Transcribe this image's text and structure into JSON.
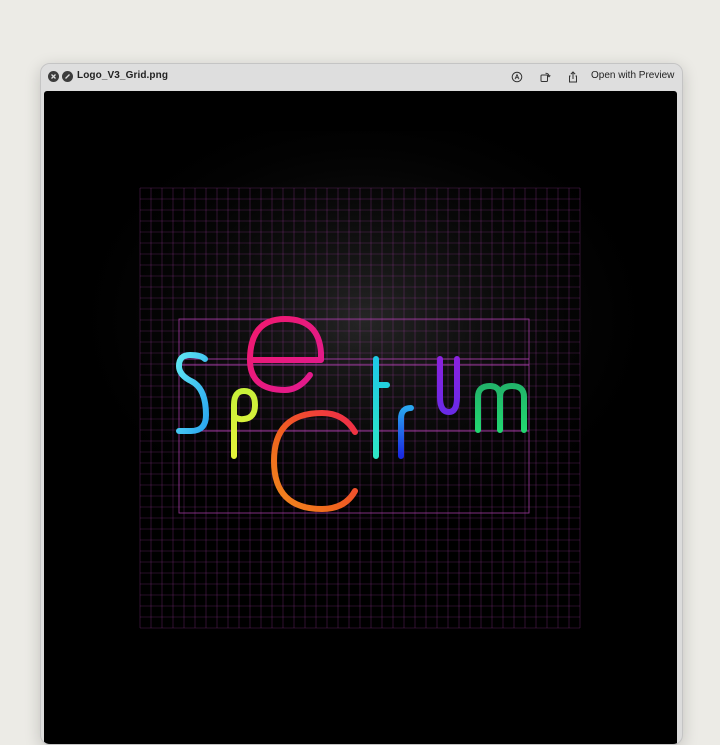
{
  "window": {
    "title": "Logo_V3_Grid.png",
    "open_with_label": "Open with Preview"
  },
  "toolbar": {
    "icons": [
      "markup-icon",
      "rotate-icon",
      "share-icon"
    ]
  },
  "image": {
    "letters": [
      {
        "char": "S",
        "color": "#3fc9f0"
      },
      {
        "char": "p",
        "color": "#c8f03a"
      },
      {
        "char": "e",
        "color": "#ee1c78"
      },
      {
        "char": "C",
        "color": "#f0581e"
      },
      {
        "char": "t",
        "color": "#1ec8e6"
      },
      {
        "char": "r",
        "color": "#2046e6"
      },
      {
        "char": "u",
        "color": "#8a22e0"
      },
      {
        "char": "m",
        "color": "#22c864"
      }
    ],
    "grid_color": "#b040b0",
    "background": "#000000"
  }
}
